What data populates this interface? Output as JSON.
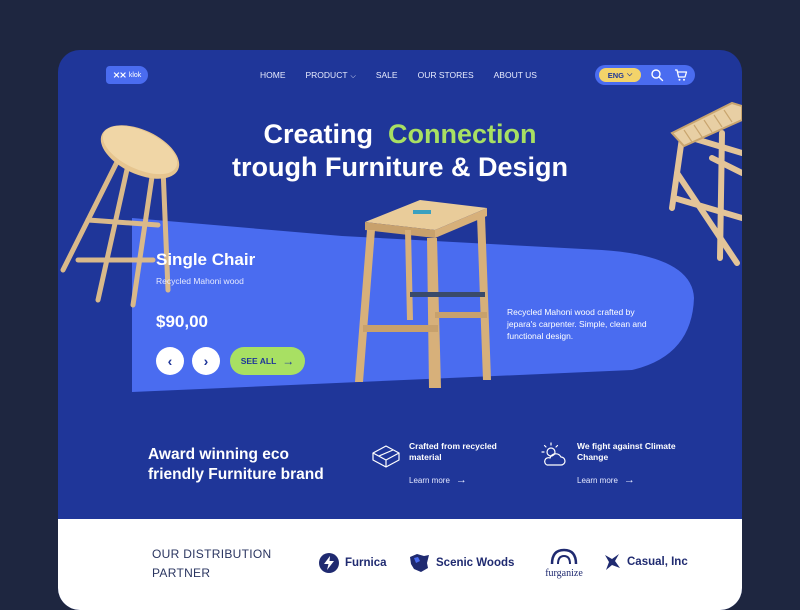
{
  "header": {
    "logo_text": "klok",
    "nav": [
      "HOME",
      "PRODUCT",
      "SALE",
      "OUR STORES",
      "ABOUT US"
    ],
    "lang": "ENG"
  },
  "hero": {
    "title_line1_a": "Creating",
    "title_line1_b": "Connection",
    "title_line2": "trough Furniture & Design"
  },
  "product": {
    "name": "Single Chair",
    "material": "Recycled Mahoni wood",
    "price": "$90,00",
    "see_all_label": "SEE ALL",
    "description": "Recycled Mahoni wood crafted by jepara's carpenter. Simple, clean and functional design."
  },
  "about": {
    "headline": "Award winning eco friendly Furniture brand",
    "features": [
      {
        "title": "Crafted from recycled material",
        "link": "Learn more",
        "icon": "cube-icon"
      },
      {
        "title": "We fight against Climate Change",
        "link": "Learn more",
        "icon": "weather-icon"
      }
    ]
  },
  "partners": {
    "title": "OUR DISTRIBUTION PARTNER",
    "items": [
      {
        "name": "Furnica",
        "icon": "bolt-icon"
      },
      {
        "name": "Scenic Woods",
        "icon": "map-icon"
      },
      {
        "name": "furganize",
        "icon": "arch-icon"
      },
      {
        "name": "Casual, Inc",
        "icon": "plane-icon"
      }
    ]
  },
  "colors": {
    "background": "#1e2640",
    "panel": "#1f3699",
    "band": "#4a6cf0",
    "accent": "#a8e063",
    "lang_pill": "#f3d36a"
  }
}
